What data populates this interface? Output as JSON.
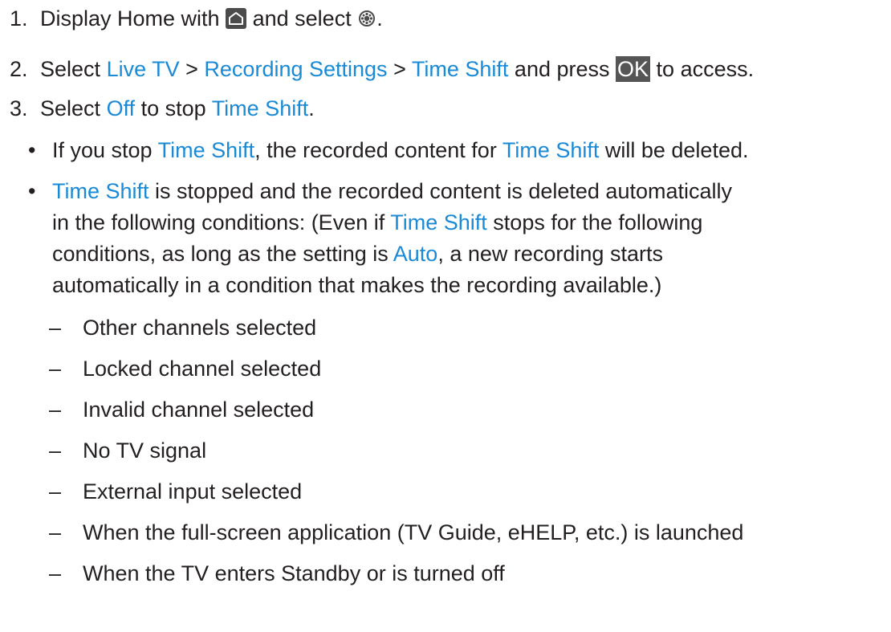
{
  "steps": [
    {
      "num": "1.",
      "t1": "Display Home with",
      "t2": "and select",
      "t3": ".",
      "icons": [
        "home-icon",
        "settings-gear-icon"
      ]
    },
    {
      "num": "2.",
      "t1": "Select",
      "l1": "Live TV",
      "s1": ">",
      "l2": "Recording Settings",
      "s2": ">",
      "l3": "Time Shift",
      "t2": "and press",
      "key": "OK",
      "t3": "to access."
    },
    {
      "num": "3.",
      "t1": "Select",
      "l1": "Off",
      "t2": "to stop",
      "l2": "Time Shift",
      "t3": "."
    }
  ],
  "notes": [
    {
      "bullet": "•",
      "t1": "If you stop",
      "l1": "Time Shift",
      "t2": ", the recorded content for",
      "l2": "Time Shift",
      "t3": "will be deleted."
    },
    {
      "bullet": "•",
      "l1": "Time Shift",
      "t1": "is stopped and the recorded content is deleted automatically",
      "line2a": "in the following conditions: (Even if",
      "l2": "Time Shift",
      "line2b": "stops for the following",
      "line3a": "conditions, as long as the setting is",
      "l3": "Auto",
      "line3b": ", a new recording starts",
      "line4": "automatically in a condition that makes the recording available.)"
    }
  ],
  "conditions": {
    "dash": "–",
    "items": [
      "Other channels selected",
      "Locked channel selected",
      "Invalid channel selected",
      "No TV signal",
      "External input selected",
      "When the full-screen application (TV Guide, eHELP, etc.) is launched",
      "When the TV enters Standby or is turned off"
    ]
  },
  "colors": {
    "link": "#1a8ad6",
    "text": "#231f20",
    "key_bg": "#555555"
  }
}
